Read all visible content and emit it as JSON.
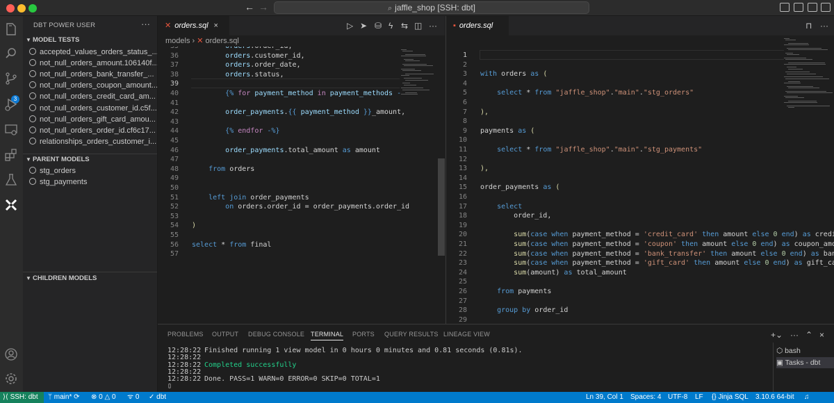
{
  "window": {
    "title": "jaffle_shop [SSH: dbt]"
  },
  "sidebar": {
    "title": "DBT POWER USER",
    "more": "···",
    "model_tests": {
      "header": "MODEL TESTS",
      "items": [
        "accepted_values_orders_status_...",
        "not_null_orders_amount.106140f...",
        "not_null_orders_bank_transfer_...",
        "not_null_orders_coupon_amount...",
        "not_null_orders_credit_card_am...",
        "not_null_orders_customer_id.c5f...",
        "not_null_orders_gift_card_amou...",
        "not_null_orders_order_id.cf6c17...",
        "relationships_orders_customer_i..."
      ]
    },
    "parent_models": {
      "header": "PARENT MODELS",
      "items": [
        "stg_orders",
        "stg_payments"
      ]
    },
    "children_models": {
      "header": "CHILDREN MODELS"
    }
  },
  "activity": {
    "badge": "3"
  },
  "editor1": {
    "tab": "orders.sql",
    "breadcrumb": [
      "models",
      "orders.sql"
    ],
    "active_line": 39
  },
  "editor2": {
    "tab": "orders.sql"
  },
  "panel": {
    "tabs": [
      "PROBLEMS",
      "OUTPUT",
      "DEBUG CONSOLE",
      "TERMINAL",
      "PORTS",
      "QUERY RESULTS",
      "LINEAGE VIEW"
    ],
    "active_tab": "TERMINAL",
    "terminal_lines": [
      {
        "time": "12:28:22",
        "text": "Finished running 1 view model in 0 hours 0 minutes and 0.81 seconds (0.81s).",
        "ok": false
      },
      {
        "time": "12:28:22",
        "text": "",
        "ok": false
      },
      {
        "time": "12:28:22",
        "text": "Completed successfully",
        "ok": true
      },
      {
        "time": "12:28:22",
        "text": "",
        "ok": false
      },
      {
        "time": "12:28:22",
        "text": "Done. PASS=1 WARN=0 ERROR=0 SKIP=0 TOTAL=1",
        "ok": false
      }
    ],
    "terminals": [
      "bash",
      "Tasks - dbt"
    ]
  },
  "statusbar": {
    "remote": "SSH: dbt",
    "branch": "main*",
    "errors": "0",
    "warnings": "0",
    "info": "0",
    "dbt": "dbt",
    "cursor": "Ln 39, Col 1",
    "spaces": "Spaces: 4",
    "encoding": "UTF-8",
    "eol": "LF",
    "language": "Jinja SQL",
    "version": "3.10.6 64-bit"
  },
  "colors": {
    "accent": "#007acc",
    "remote": "#16825d",
    "dbt": "#e8553c"
  }
}
